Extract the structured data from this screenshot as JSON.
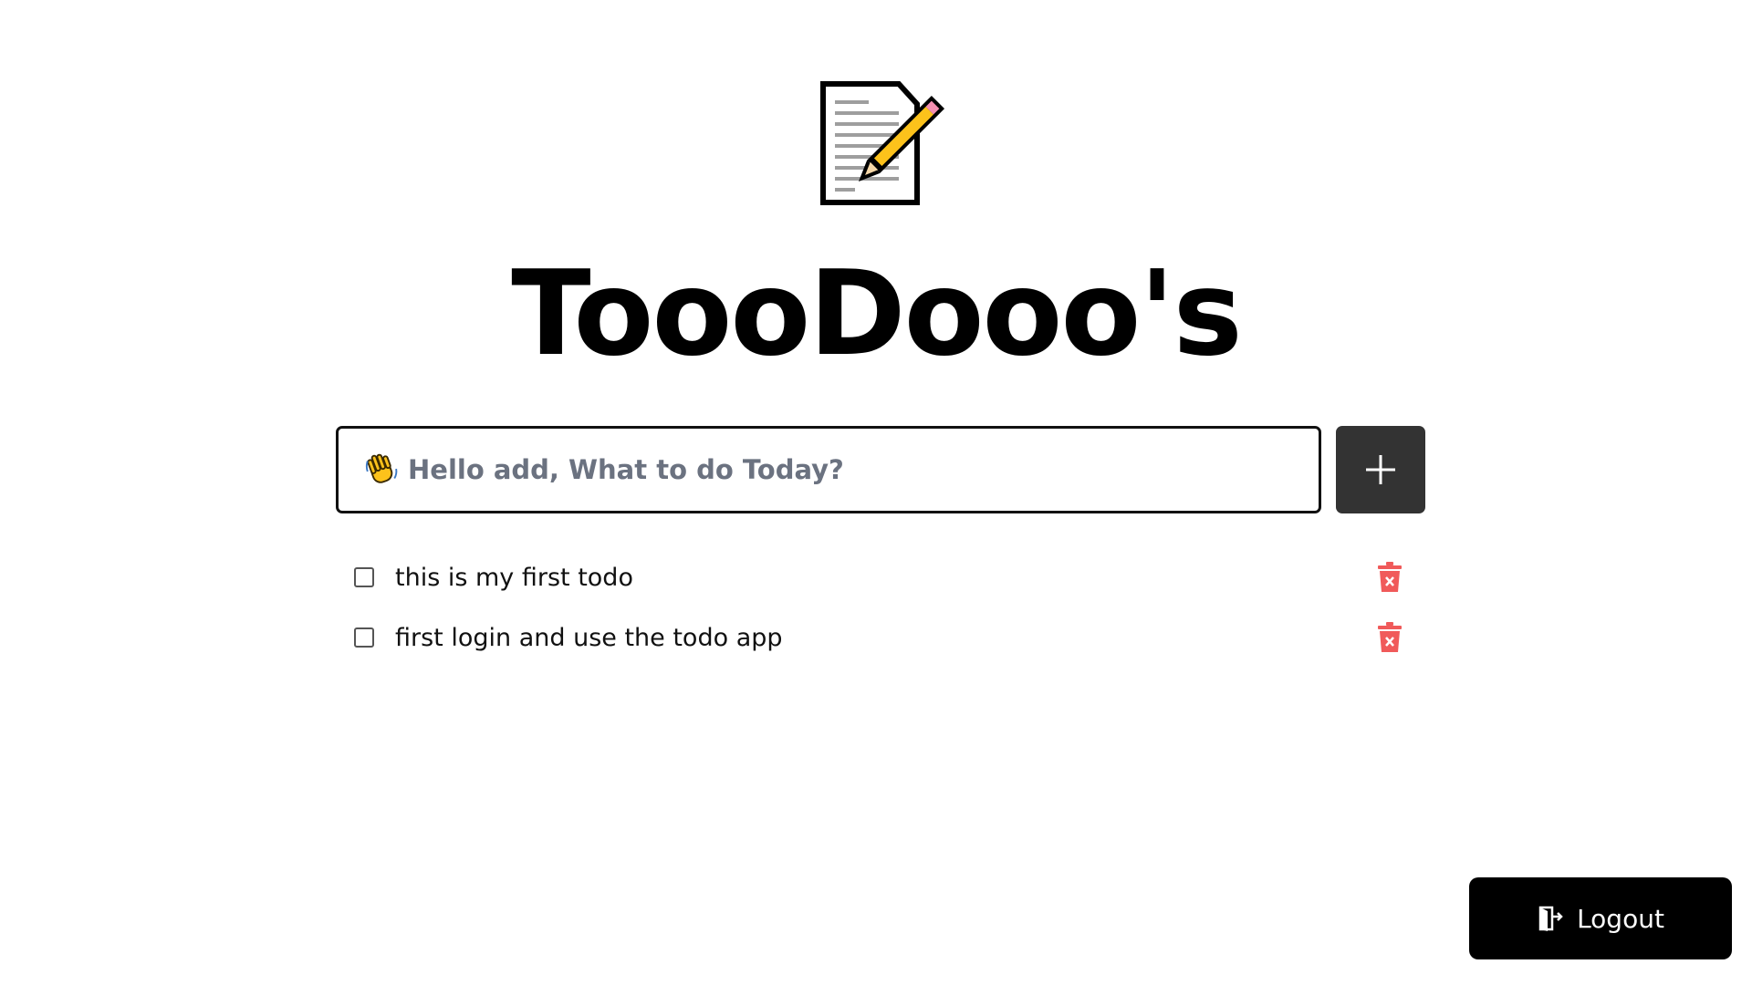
{
  "header": {
    "icon": "memo-icon",
    "title": "ToooDooo's"
  },
  "input": {
    "icon": "waving-hand-icon",
    "placeholder": "Hello add, What to do Today?",
    "value": ""
  },
  "add_button": {
    "icon": "plus-icon"
  },
  "todos": [
    {
      "text": "this is my first todo",
      "completed": false
    },
    {
      "text": "first login and use the todo app",
      "completed": false
    }
  ],
  "delete_icon": "trash-x-icon",
  "logout": {
    "label": "Logout",
    "icon": "door-exit-icon"
  },
  "colors": {
    "delete": "#f05a5a",
    "add_button_bg": "#333333",
    "logout_bg": "#000000",
    "placeholder": "#6b7280"
  }
}
